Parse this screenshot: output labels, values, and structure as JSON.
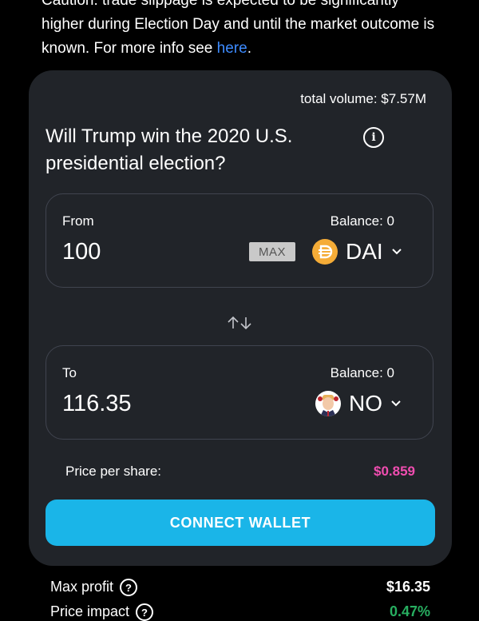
{
  "caution": {
    "line1": "Caution: trade slippage is expected to be significantly",
    "line2": "higher during Election Day and until the market outcome is",
    "line3_prefix": "known. For more info see ",
    "link": "here",
    "line3_suffix": "."
  },
  "card": {
    "total_volume": "total volume: $7.57M",
    "question": "Will Trump win the 2020 U.S. presidential election?",
    "from": {
      "label": "From",
      "balance": "Balance: 0",
      "amount": "100",
      "max_label": "MAX",
      "token": "DAI"
    },
    "to": {
      "label": "To",
      "balance": "Balance: 0",
      "amount": "116.35",
      "token": "NO"
    },
    "price_label": "Price per share:",
    "price_value": "$0.859",
    "connect_label": "CONNECT WALLET"
  },
  "stats": {
    "max_profit_label": "Max profit",
    "max_profit_value": "$16.35",
    "price_impact_label": "Price impact",
    "price_impact_value": "0.47%"
  },
  "colors": {
    "accent": "#1ab5e8",
    "price": "#f04db0",
    "link": "#3d8bff",
    "card_bg": "#212429",
    "positive": "#27ae60"
  },
  "icons": [
    "info-icon",
    "dai-token-icon",
    "trump-token-icon",
    "chevron-down-icon",
    "swap-arrows-icon",
    "help-icon"
  ]
}
